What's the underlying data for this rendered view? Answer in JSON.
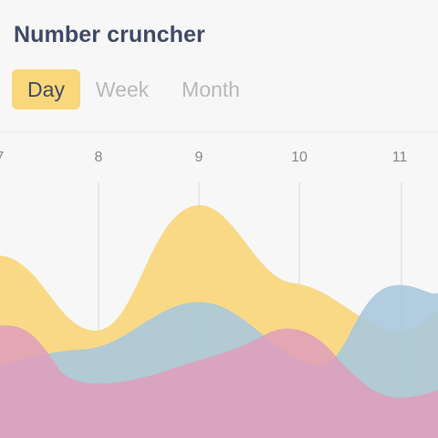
{
  "app": {
    "title": "Number cruncher"
  },
  "tabs": [
    {
      "label": "Day",
      "active": true
    },
    {
      "label": "Week",
      "active": false
    },
    {
      "label": "Month",
      "active": false
    }
  ],
  "colors": {
    "accent": "#f9d77a",
    "title": "#404a68",
    "yellow_series": "#f8d67c",
    "blue_series": "#a9c8dc",
    "pink_series": "#df9dbb"
  },
  "chart_data": {
    "type": "area",
    "x_ticks": [
      "7",
      "8",
      "9",
      "10",
      "11"
    ]
  }
}
